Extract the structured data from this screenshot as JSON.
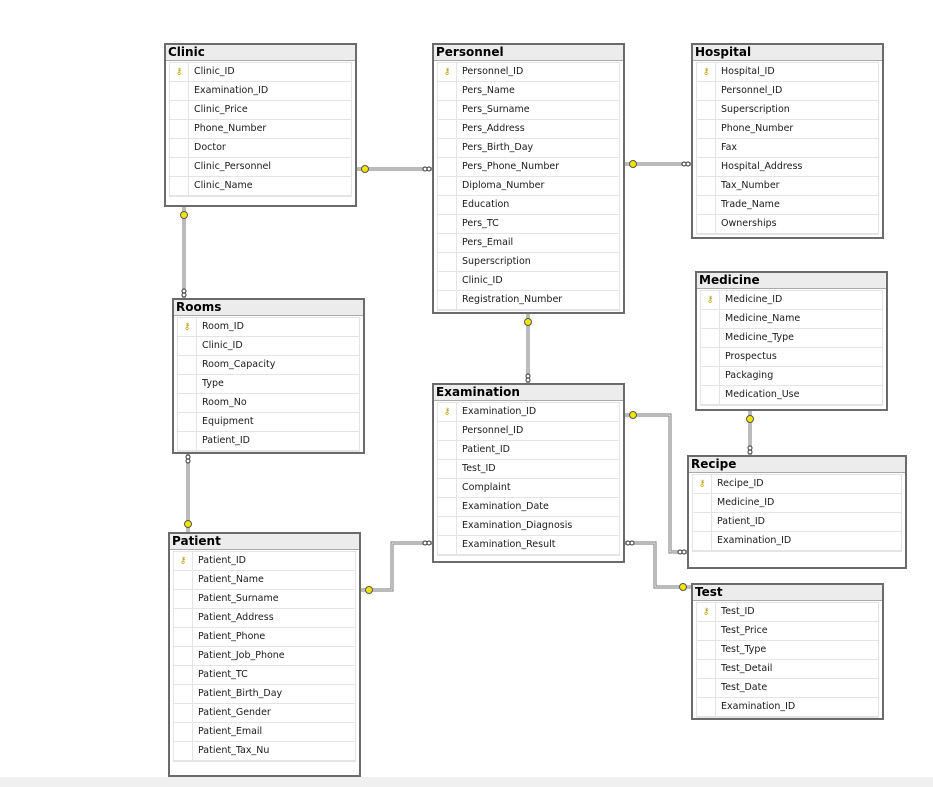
{
  "tables": [
    {
      "name": "Clinic",
      "pk": "Clinic_ID",
      "columns": [
        "Clinic_ID",
        "Examination_ID",
        "Clinic_Price",
        "Phone_Number",
        "Doctor",
        "Clinic_Personnel",
        "Clinic_Name"
      ]
    },
    {
      "name": "Personnel",
      "pk": "Personnel_ID",
      "columns": [
        "Personnel_ID",
        "Pers_Name",
        "Pers_Surname",
        "Pers_Address",
        "Pers_Birth_Day",
        "Pers_Phone_Number",
        "Diploma_Number",
        "Education",
        "Pers_TC",
        "Pers_Email",
        "Superscription",
        "Clinic_ID",
        "Registration_Number"
      ]
    },
    {
      "name": "Hospital",
      "pk": "Hospital_ID",
      "columns": [
        "Hospital_ID",
        "Personnel_ID",
        "Superscription",
        "Phone_Number",
        "Fax",
        "Hospital_Address",
        "Tax_Number",
        "Trade_Name",
        "Ownerships"
      ]
    },
    {
      "name": "Medicine",
      "pk": "Medicine_ID",
      "columns": [
        "Medicine_ID",
        "Medicine_Name",
        "Medicine_Type",
        "Prospectus",
        "Packaging",
        "Medication_Use"
      ]
    },
    {
      "name": "Rooms",
      "pk": "Room_ID",
      "columns": [
        "Room_ID",
        "Clinic_ID",
        "Room_Capacity",
        "Type",
        "Room_No",
        "Equipment",
        "Patient_ID"
      ]
    },
    {
      "name": "Examination",
      "pk": "Examination_ID",
      "columns": [
        "Examination_ID",
        "Personnel_ID",
        "Patient_ID",
        "Test_ID",
        "Complaint",
        "Examination_Date",
        "Examination_Diagnosis",
        "Examination_Result"
      ]
    },
    {
      "name": "Recipe",
      "pk": "Recipe_ID",
      "columns": [
        "Recipe_ID",
        "Medicine_ID",
        "Patient_ID",
        "Examination_ID"
      ]
    },
    {
      "name": "Patient",
      "pk": "Patient_ID",
      "columns": [
        "Patient_ID",
        "Patient_Name",
        "Patient_Surname",
        "Patient_Address",
        "Patient_Phone",
        "Patient_Job_Phone",
        "Patient_TC",
        "Patient_Birth_Day",
        "Patient_Gender",
        "Patient_Email",
        "Patient_Tax_Nu"
      ]
    },
    {
      "name": "Test",
      "pk": "Test_ID",
      "columns": [
        "Test_ID",
        "Test_Price",
        "Test_Type",
        "Test_Detail",
        "Test_Date",
        "Examination_ID"
      ]
    }
  ],
  "relationships": [
    {
      "one": "Clinic",
      "many": "Personnel"
    },
    {
      "one": "Personnel",
      "many": "Hospital"
    },
    {
      "one": "Clinic",
      "many": "Rooms"
    },
    {
      "one": "Patient",
      "many": "Rooms"
    },
    {
      "one": "Personnel",
      "many": "Examination"
    },
    {
      "one": "Patient",
      "many": "Examination"
    },
    {
      "one": "Examination",
      "many": "Recipe"
    },
    {
      "one": "Test",
      "many": "Examination"
    },
    {
      "one": "Medicine",
      "many": "Recipe"
    }
  ],
  "colors": {
    "key": "#f2e600",
    "border": "#6b6b6b",
    "header": "#ececec"
  }
}
